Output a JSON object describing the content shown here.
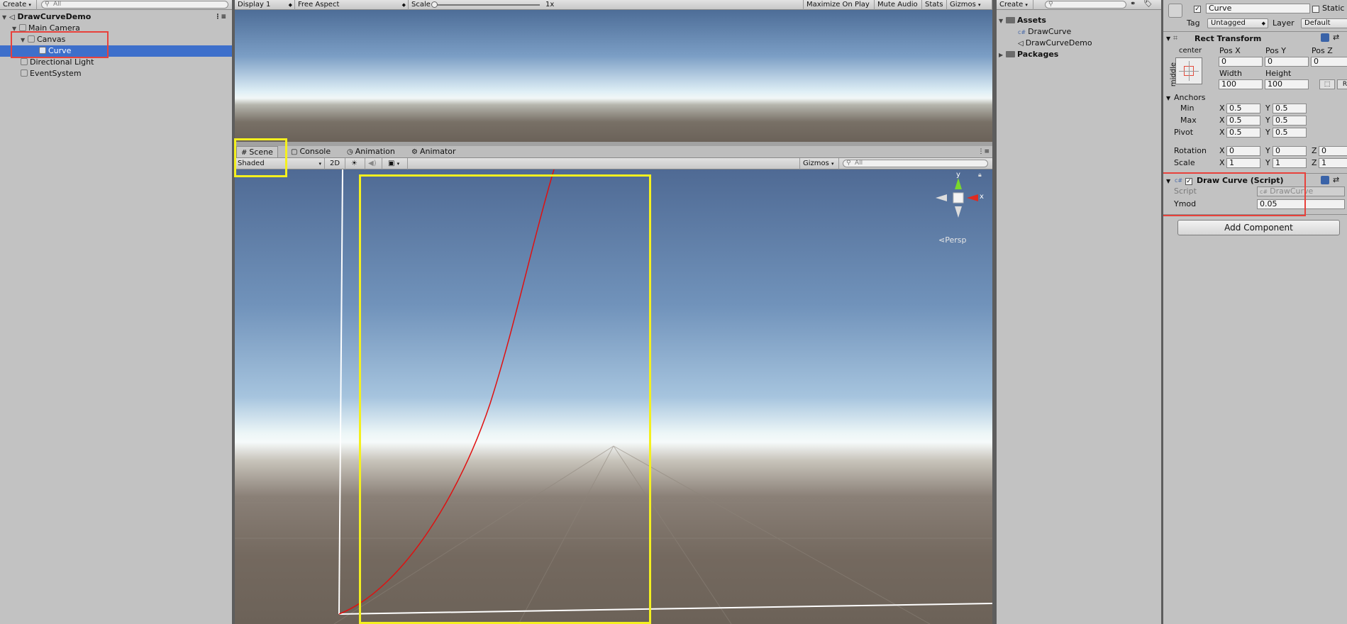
{
  "hierarchy": {
    "create_label": "Create",
    "search_placeholder": "All",
    "scene_name": "DrawCurveDemo",
    "items": [
      "Main Camera",
      "Canvas",
      "Curve",
      "Directional Light",
      "EventSystem"
    ]
  },
  "game_view": {
    "display": "Display 1",
    "aspect": "Free Aspect",
    "scale_label": "Scale",
    "scale_value": "1x",
    "scale_level": 0,
    "buttons": [
      "Maximize On Play",
      "Mute Audio",
      "Stats",
      "Gizmos"
    ]
  },
  "scene_tabs": [
    "Scene",
    "Console",
    "Animation",
    "Animator"
  ],
  "scene_view": {
    "shading": "Shaded",
    "mode_2d": "2D",
    "gizmos_label": "Gizmos",
    "search_placeholder": "All",
    "persp_label": "Persp",
    "axis_y": "y",
    "axis_x": "x"
  },
  "project": {
    "create_label": "Create",
    "assets_label": "Assets",
    "assets": [
      "DrawCurve",
      "DrawCurveDemo"
    ],
    "packages_label": "Packages"
  },
  "inspector": {
    "object_name": "Curve",
    "static_label": "Static",
    "tag_label": "Tag",
    "tag_value": "Untagged",
    "layer_label": "Layer",
    "layer_value": "Default",
    "rect_transform": {
      "title": "Rect Transform",
      "anchor_h": "center",
      "anchor_v": "middle",
      "pos_labels": [
        "Pos X",
        "Pos Y",
        "Pos Z"
      ],
      "pos_values": [
        "0",
        "0",
        "0"
      ],
      "size_labels": [
        "Width",
        "Height"
      ],
      "size_values": [
        "100",
        "100"
      ],
      "anchors_label": "Anchors",
      "min_label": "Min",
      "min_x": "0.5",
      "min_y": "0.5",
      "max_label": "Max",
      "max_x": "0.5",
      "max_y": "0.5",
      "pivot_label": "Pivot",
      "pivot_x": "0.5",
      "pivot_y": "0.5",
      "rotation_label": "Rotation",
      "rotation": [
        "0",
        "0",
        "0"
      ],
      "scale_label": "Scale",
      "scale": [
        "1",
        "1",
        "1"
      ],
      "x": "X",
      "y": "Y",
      "z": "Z"
    },
    "draw_curve": {
      "title": "Draw Curve (Script)",
      "script_label": "Script",
      "script_value": "DrawCurve",
      "ymod_label": "Ymod",
      "ymod_value": "0.05"
    },
    "add_component": "Add Component"
  },
  "colors": {
    "selection": "#3d6fcb",
    "annotation_red": "#e8413b",
    "annotation_yellow": "#f4f01f",
    "curve": "#e01010"
  }
}
